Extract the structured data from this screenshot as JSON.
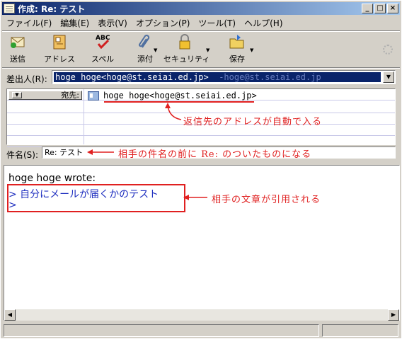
{
  "window": {
    "title": "作成: Re: テスト",
    "minimize": "_",
    "maximize": "□",
    "close": "×"
  },
  "menu": [
    "ファイル(F)",
    "編集(E)",
    "表示(V)",
    "オプション(P)",
    "ツール(T)",
    "ヘルプ(H)"
  ],
  "toolbar": {
    "send": "送信",
    "address": "アドレス",
    "spell": "スペル",
    "spell_icon_text": "ABC",
    "attach": "添付",
    "security": "セキュリティ",
    "save": "保存"
  },
  "compose": {
    "from_label": "差出人(R):",
    "from_value": "hoge hoge<hoge@st.seiai.ed.jp>",
    "from_account": "-hoge@st.seiai.ed.jp",
    "recipient_type": "宛先:",
    "recipient_value": "hoge hoge<hoge@st.seiai.ed.jp>",
    "subject_label": "件名(S):",
    "subject_value": "Re: テスト"
  },
  "body": {
    "attribution": "hoge hoge wrote:",
    "quote_line1": "> 自分にメールが届くかのテスト",
    "quote_line2": ">"
  },
  "annotations": {
    "recipient_note": "返信先のアドレスが自動で入る",
    "subject_note": "相手の件名の前に Re: のついたものになる",
    "quote_note": "相手の文章が引用される"
  },
  "colors": {
    "annotation": "#e02020",
    "quote": "#2030c0",
    "selection": "#0a246a"
  }
}
